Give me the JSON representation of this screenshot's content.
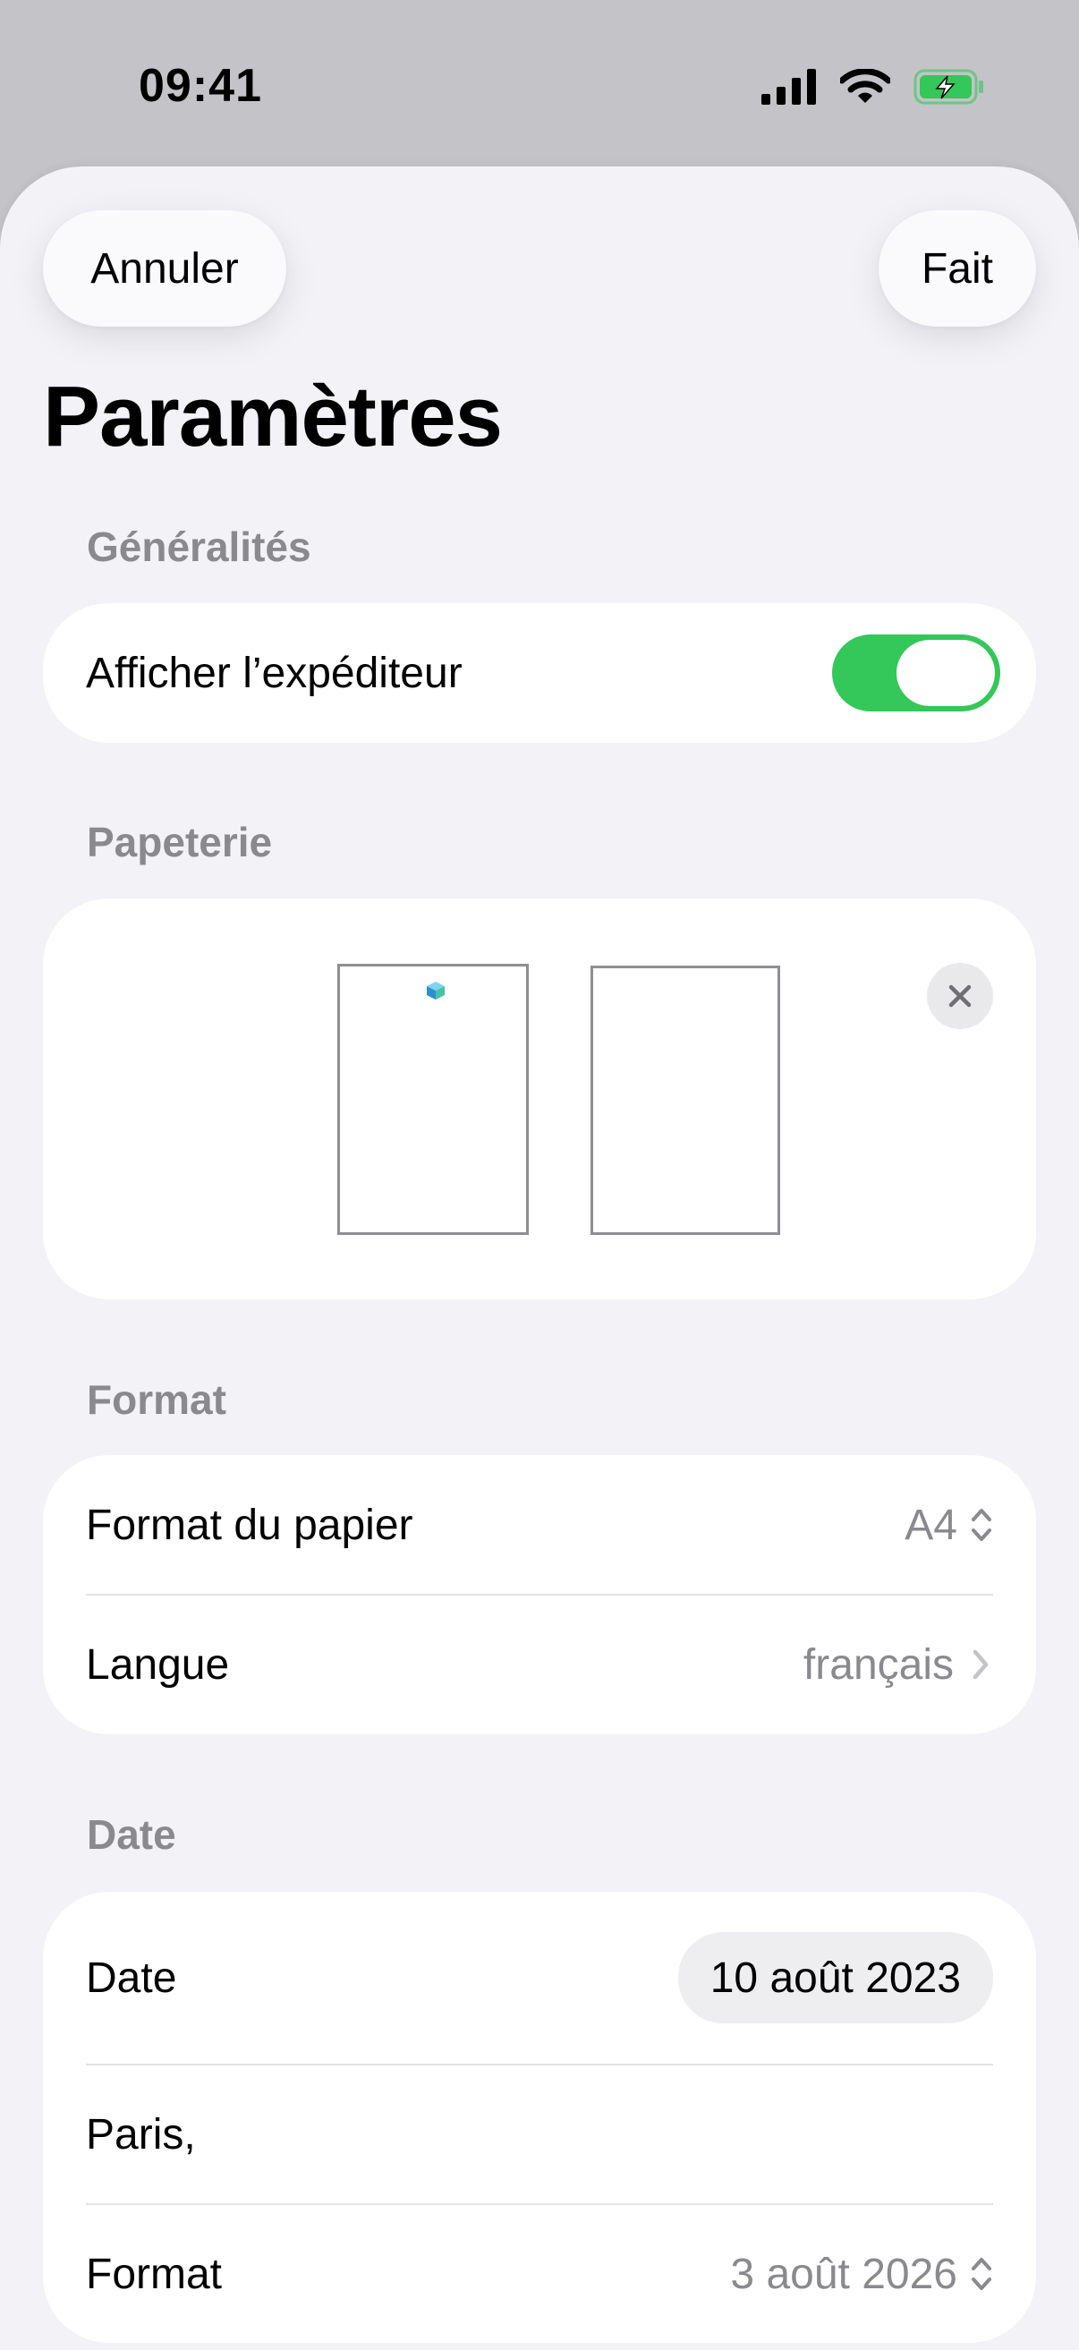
{
  "status_bar": {
    "time": "09:41",
    "battery_color": "#34c759"
  },
  "nav": {
    "cancel_label": "Annuler",
    "done_label": "Fait"
  },
  "page_title": "Paramètres",
  "sections": {
    "general": {
      "header": "Généralités",
      "show_sender_label": "Afficher l’expéditeur",
      "show_sender_on": true
    },
    "stationery": {
      "header": "Papeterie"
    },
    "format": {
      "header": "Format",
      "paper_size_label": "Format du papier",
      "paper_size_value": "A4",
      "language_label": "Langue",
      "language_value": "français"
    },
    "date": {
      "header": "Date",
      "date_label": "Date",
      "date_value": "10 août 2023",
      "place_text": "Paris,",
      "format_label": "Format",
      "format_value": "3 août 2026"
    }
  },
  "colors": {
    "accent_green": "#34c759",
    "secondary_text": "#8a8a8e"
  }
}
